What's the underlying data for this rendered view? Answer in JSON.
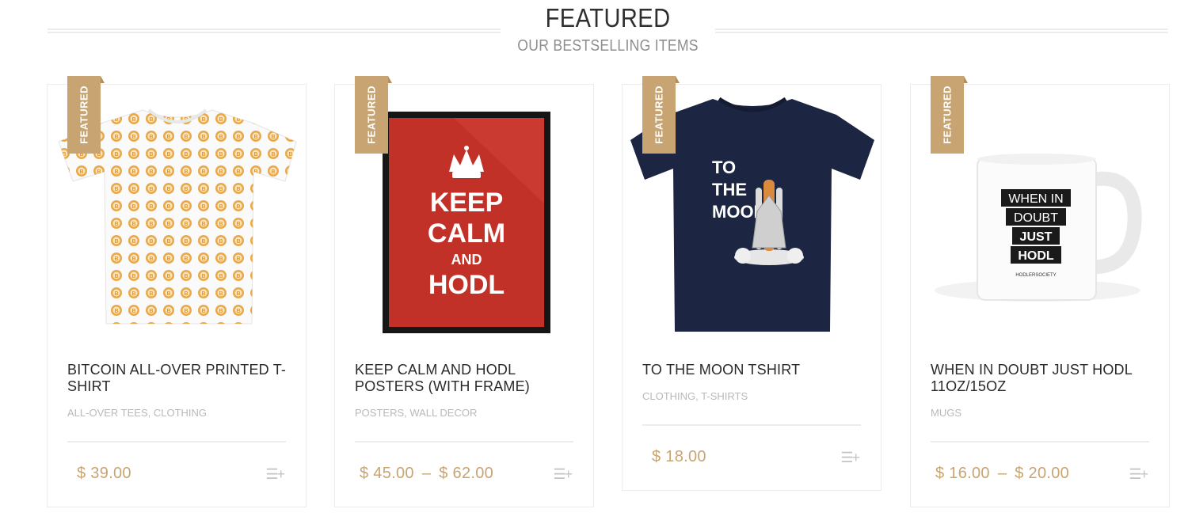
{
  "section": {
    "title": "FEATURED",
    "subtitle": "OUR BESTSELLING ITEMS"
  },
  "colors": {
    "accent": "#c8a472",
    "text": "#2a2a2a",
    "muted": "#b9b9b9"
  },
  "products": [
    {
      "badge": "FEATURED",
      "name": "BITCOIN ALL-OVER PRINTED T-SHIRT",
      "categories": "ALL-OVER TEES, CLOTHING",
      "price_from": "$ 39.00",
      "price_sep": "",
      "price_to": "",
      "add_icon": "add-to-cart-icon"
    },
    {
      "badge": "FEATURED",
      "name": "KEEP CALM AND HODL POSTERS (WITH FRAME)",
      "categories": "POSTERS, WALL DECOR",
      "price_from": "$ 45.00",
      "price_sep": "–",
      "price_to": "$ 62.00",
      "add_icon": "add-to-cart-icon",
      "image_text": [
        "KEEP",
        "CALM",
        "AND",
        "HODL"
      ]
    },
    {
      "badge": "FEATURED",
      "name": "TO THE MOON TSHIRT",
      "categories": "CLOTHING, T-SHIRTS",
      "price_from": "$ 18.00",
      "price_sep": "",
      "price_to": "",
      "add_icon": "add-to-cart-icon",
      "image_text": [
        "TO",
        "THE",
        "MOON"
      ]
    },
    {
      "badge": "FEATURED",
      "name": "WHEN IN DOUBT JUST HODL 11OZ/15OZ",
      "categories": "MUGS",
      "price_from": "$ 16.00",
      "price_sep": "–",
      "price_to": "$ 20.00",
      "add_icon": "add-to-cart-icon",
      "image_text": [
        "WHEN IN",
        "DOUBT",
        "JUST",
        "HODL",
        "HODLERSOCIETY"
      ]
    }
  ]
}
